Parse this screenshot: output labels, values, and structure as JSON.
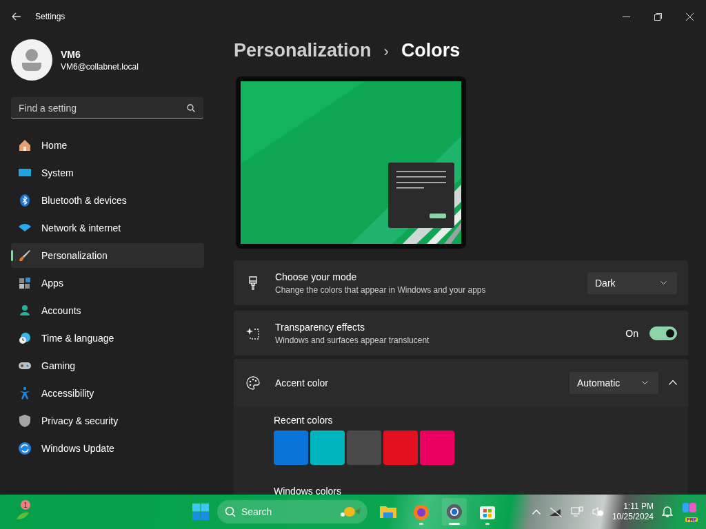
{
  "window": {
    "title": "Settings"
  },
  "profile": {
    "name": "VM6",
    "email": "VM6@collabnet.local"
  },
  "search": {
    "placeholder": "Find a setting"
  },
  "sidebar": {
    "items": [
      {
        "label": "Home",
        "selected": false
      },
      {
        "label": "System",
        "selected": false
      },
      {
        "label": "Bluetooth & devices",
        "selected": false
      },
      {
        "label": "Network & internet",
        "selected": false
      },
      {
        "label": "Personalization",
        "selected": true
      },
      {
        "label": "Apps",
        "selected": false
      },
      {
        "label": "Accounts",
        "selected": false
      },
      {
        "label": "Time & language",
        "selected": false
      },
      {
        "label": "Gaming",
        "selected": false
      },
      {
        "label": "Accessibility",
        "selected": false
      },
      {
        "label": "Privacy & security",
        "selected": false
      },
      {
        "label": "Windows Update",
        "selected": false
      }
    ]
  },
  "breadcrumb": {
    "parent": "Personalization",
    "separator": "›",
    "current": "Colors"
  },
  "settings": [
    {
      "kind": "dropdown",
      "title": "Choose your mode",
      "description": "Change the colors that appear in Windows and your apps",
      "value": "Dark"
    },
    {
      "kind": "toggle",
      "title": "Transparency effects",
      "description": "Windows and surfaces appear translucent",
      "state_label": "On",
      "on": true
    },
    {
      "kind": "expander",
      "title": "Accent color",
      "value": "Automatic",
      "expanded": true
    }
  ],
  "accent": {
    "recent_label": "Recent colors",
    "recent_colors": [
      {
        "color": "#0b74d9"
      },
      {
        "color": "#00b5bd"
      },
      {
        "color": "#4a4a4a"
      },
      {
        "color": "#e3101f"
      },
      {
        "color": "#ea005e"
      }
    ],
    "windows_label": "Windows colors"
  },
  "taskbar": {
    "widget_badge": "1",
    "search_placeholder": "Search",
    "apps": [
      {
        "running": false,
        "active": false
      },
      {
        "running": true,
        "active": false
      },
      {
        "running": true,
        "active": true
      },
      {
        "running": true,
        "active": false
      }
    ],
    "time": "1:11 PM",
    "date": "10/25/2024",
    "copilot_badge": "PRE"
  }
}
